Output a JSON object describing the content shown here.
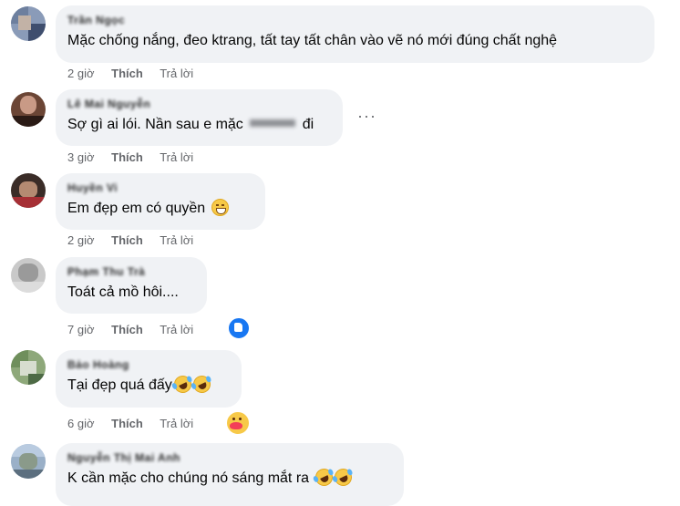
{
  "comments": [
    {
      "name": "Trần Ngọc",
      "text": "Mặc chống nắng, đeo ktrang, tất tay tất chân vào vẽ nó mới đúng chất nghệ",
      "time": "2 giờ",
      "like": "Thích",
      "reply": "Trả lời",
      "emojis": []
    },
    {
      "name": "Lê Mai Nguyễn",
      "text": "Sợ gì ai lói. Nần sau e mặc",
      "text_tail": "đi",
      "time": "3 giờ",
      "like": "Thích",
      "reply": "Trả lời",
      "emojis": []
    },
    {
      "name": "Huyền Vi",
      "text": "Em đẹp em có quyền",
      "time": "2 giờ",
      "like": "Thích",
      "reply": "Trả lời",
      "emojis": [
        "grinning-face"
      ]
    },
    {
      "name": "Phạm Thu Trà",
      "text": "Toát cả mồ hôi....",
      "time": "7 giờ",
      "like": "Thích",
      "reply": "Trả lời",
      "emojis": [],
      "reaction": "like"
    },
    {
      "name": "Bảo Hoàng",
      "text": "Tại đẹp quá đấy",
      "time": "6 giờ",
      "like": "Thích",
      "reply": "Trả lời",
      "emojis": [
        "rofl-face",
        "rofl-face"
      ],
      "reaction": "care"
    },
    {
      "name": "Nguyễn Thị Mai Anh",
      "text": "K cần mặc cho chúng nó sáng mắt ra",
      "time": "",
      "like": "",
      "reply": "",
      "emojis": [
        "rofl-face",
        "rofl-face"
      ]
    }
  ],
  "more_menu": "···",
  "colors": {
    "bubble": "#f0f2f5",
    "meta": "#65676b",
    "like_blue": "#1877f2"
  }
}
